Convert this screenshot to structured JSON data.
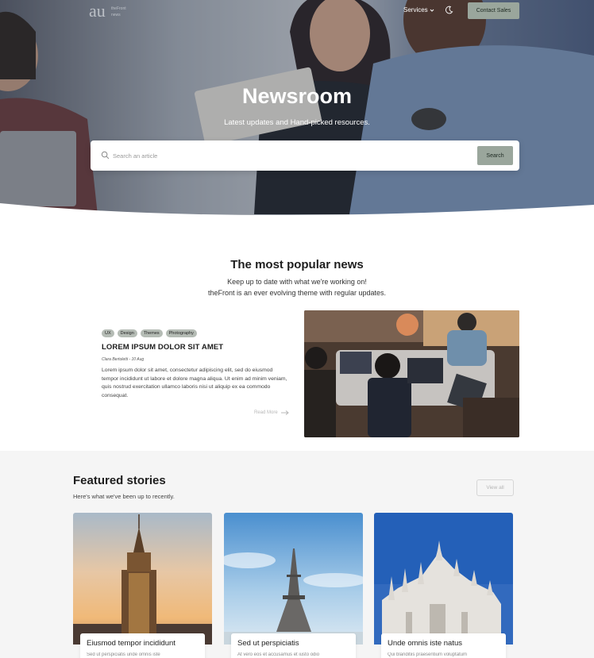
{
  "nav": {
    "logo_alt": "theFront logo",
    "services_label": "Services",
    "contact_label": "Contact Sales"
  },
  "hero": {
    "title": "Newsroom",
    "subtitle": "Latest updates and Hand-picked resources.",
    "search_placeholder": "Search an article",
    "search_button": "Search"
  },
  "popular": {
    "title": "The most popular news",
    "subtitle_line1": "Keep up to date with what we're working on!",
    "subtitle_line2": "theFront is an ever evolving theme with regular updates.",
    "article": {
      "tags": [
        "UX",
        "Design",
        "Themes",
        "Photography"
      ],
      "title": "LOREM IPSUM DOLOR SIT AMET",
      "meta": "Clara Bertoletti - 10 Aug",
      "body": "Lorem ipsum dolor sit amet, consectetur adipiscing elit, sed do eiusmod tempor incididunt ut labore et dolore magna aliqua. Ut enim ad minim veniam, quis nostrud exercitation ullamco laboris nisi ut aliquip ex ea commodo consequat.",
      "read_more": "Read More"
    }
  },
  "featured": {
    "title": "Featured stories",
    "subtitle": "Here's what we've been up to recently.",
    "view_all": "View all",
    "cards": [
      {
        "title": "Eiusmod tempor incididunt",
        "text": "Sed ut perspiciatis unde omnis iste"
      },
      {
        "title": "Sed ut perspiciatis",
        "text": "At vero eos et accusamus et iusto odio"
      },
      {
        "title": "Unde omnis iste natus",
        "text": "Qui blanditiis praesentium voluptatum"
      }
    ]
  },
  "colors": {
    "accent": "#9aa69c",
    "tag_bg": "#b5bcb5",
    "featured_bg": "#f5f5f5"
  }
}
